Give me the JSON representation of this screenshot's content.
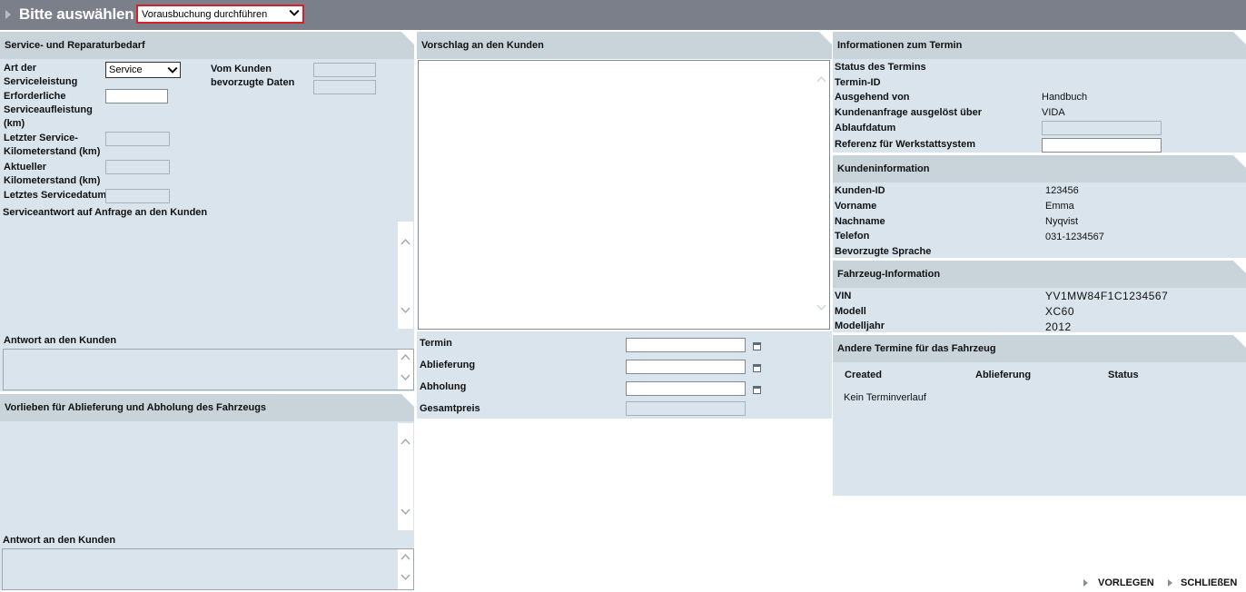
{
  "topbar": {
    "title": "Bitte auswählen",
    "action_select": "Vorausbuchung durchführen",
    "accent_color": "#d8202a"
  },
  "service_panel": {
    "title": "Service- und Reparaturbedarf",
    "art_label": "Art der Serviceleistung",
    "art_value": "Service",
    "erforderliche_label": "Erforderliche Serviceaufleistung (km)",
    "erforderliche_value": "",
    "letzter_km_label": "Letzter Service-Kilometerstand (km)",
    "aktueller_km_label": "Aktueller Kilometerstand (km)",
    "letztes_datum_label": "Letztes Servicedatum",
    "bevorzugte_label": "Vom Kunden bevorzugte Daten",
    "serviceantwort_label": "Serviceantwort auf Anfrage an den Kunden",
    "antwort_label": "Antwort an den Kunden"
  },
  "vorlieben_panel": {
    "title": "Vorlieben für Ablieferung und Abholung des Fahrzeugs",
    "antwort_label": "Antwort an den Kunden"
  },
  "vorschlag_panel": {
    "title": "Vorschlag an den Kunden",
    "termin_label": "Termin",
    "ablieferung_label": "Ablieferung",
    "abholung_label": "Abholung",
    "gesamtpreis_label": "Gesamtpreis"
  },
  "termin_info": {
    "title": "Informationen zum Termin",
    "status_label": "Status des Termins",
    "id_label": "Termin-ID",
    "ausgehend_label": "Ausgehend von",
    "ausgehend_value": "Handbuch",
    "kundenanfrage_label": "Kundenanfrage ausgelöst über",
    "kundenanfrage_value": "VIDA",
    "ablaufdatum_label": "Ablaufdatum",
    "referenz_label": "Referenz für Werkstattsystem"
  },
  "kunden_info": {
    "title": "Kundeninformation",
    "id_label": "Kunden-ID",
    "id_value": "123456",
    "vorname_label": "Vorname",
    "vorname_value": "Emma",
    "nachname_label": "Nachname",
    "nachname_value": "Nyqvist",
    "telefon_label": "Telefon",
    "telefon_value": "031-1234567",
    "sprache_label": "Bevorzugte Sprache"
  },
  "fahrzeug_info": {
    "title": "Fahrzeug-Information",
    "vin_label": "VIN",
    "vin_value": "YV1MW84F1C1234567",
    "modell_label": "Modell",
    "modell_value": "XC60",
    "jahr_label": "Modelljahr",
    "jahr_value": "2012"
  },
  "andere_termine": {
    "title": "Andere Termine für das Fahrzeug",
    "col_created": "Created",
    "col_ablieferung": "Ablieferung",
    "col_status": "Status",
    "empty_text": "Kein Terminverlauf"
  },
  "footer": {
    "vorlegen": "VORLEGEN",
    "schliessen": "SCHLIEßEN"
  }
}
